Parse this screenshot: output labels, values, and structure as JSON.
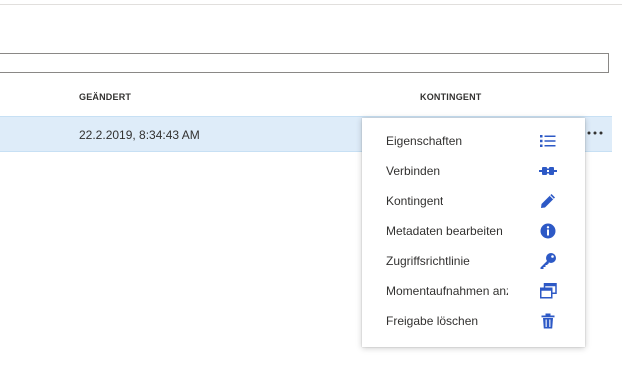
{
  "table": {
    "columns": {
      "geaendert": "GEÄNDERT",
      "kontingent": "KONTINGENT"
    },
    "rows": [
      {
        "geaendert": "22.2.2019, 8:34:43 AM"
      }
    ]
  },
  "context_menu": {
    "items": [
      {
        "label": "Eigenschaften",
        "icon": "list-icon"
      },
      {
        "label": "Verbinden",
        "icon": "connect-plug-icon"
      },
      {
        "label": "Kontingent",
        "icon": "pencil-icon"
      },
      {
        "label": "Metadaten bearbeiten",
        "icon": "info-icon"
      },
      {
        "label": "Zugriffsrichtlinie",
        "icon": "key-icon"
      },
      {
        "label": "Momentaufnahmen anz...",
        "icon": "snapshots-icon"
      },
      {
        "label": "Freigabe löschen",
        "icon": "trash-icon"
      }
    ]
  },
  "colors": {
    "accent": "#2d59c6",
    "row_selected": "#deecf9",
    "text": "#323130"
  }
}
